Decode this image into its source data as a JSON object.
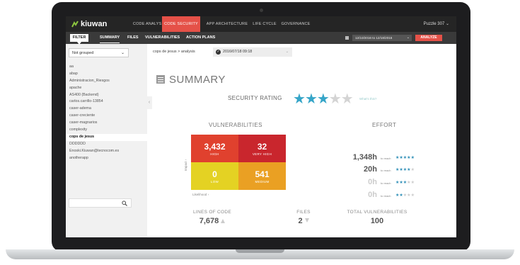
{
  "topnav": {
    "logo": "kiuwan",
    "items": [
      {
        "label": "CODE ANALYSIS"
      },
      {
        "label": "CODE SECURITY"
      },
      {
        "label": "APP ARCHITECTURE"
      },
      {
        "label": "LIFE CYCLE"
      },
      {
        "label": "GOVERNANCE"
      }
    ],
    "project": "Puzzle 307 ⌄"
  },
  "subnav": {
    "filter_label": "FILTER",
    "tabs": [
      {
        "label": "SUMMARY"
      },
      {
        "label": "FILES"
      },
      {
        "label": "VULNERABILITIES"
      },
      {
        "label": "ACTION PLANS"
      }
    ],
    "date_range": "12/10/2016 to 12/18/2016",
    "analyze_label": "ANALYZE"
  },
  "sidebar": {
    "group_select": "Not grouped",
    "apps": [
      "aa",
      "abap",
      "Administracion_Riesgos",
      "apache",
      "AS400 (Backend)",
      "carlos.carrillo-13854",
      "caser-adema",
      "caser-creciente",
      "caser-magnarios",
      "complexity",
      "cops de jesus",
      "DDDDDD",
      "Enoski.Kiuwan@tecnocom.es",
      "anotherapp"
    ],
    "selected_index": 10,
    "search_value": ""
  },
  "breadcrumb": {
    "path": "cops de jesus  >  analysis",
    "snapshot": "2016/07/18 09:18"
  },
  "summary": {
    "title": "SUMMARY",
    "rating_label": "SECURITY RATING",
    "rating_value": 3,
    "rating_max": 5,
    "whats_this": "What's this?"
  },
  "vulnerabilities": {
    "title": "VULNERABILITIES",
    "cells": [
      {
        "value": "3,432",
        "label": "HIGH",
        "color": "#e0412e"
      },
      {
        "value": "32",
        "label": "VERY HIGH",
        "color": "#c9262d"
      },
      {
        "value": "0",
        "label": "LOW",
        "color": "#e4d223"
      },
      {
        "value": "541",
        "label": "MEDIUM",
        "color": "#eaa023"
      }
    ],
    "impact_label": "Impact ›",
    "likelihood_label": "Likelihood ›"
  },
  "effort": {
    "title": "EFFORT",
    "rows": [
      {
        "hours": "1,348h",
        "reach": "to reach",
        "stars": 5
      },
      {
        "hours": "20h",
        "reach": "to reach",
        "stars": 4
      },
      {
        "hours": "0h",
        "reach": "to reach",
        "stars": 3
      },
      {
        "hours": "0h",
        "reach": "to reach",
        "stars": 2
      }
    ],
    "colors": {
      "active": "#2f8fb7",
      "dim": "#cccccc"
    }
  },
  "metrics": [
    {
      "label": "LINES OF CODE",
      "value": "7,678",
      "trend": "up"
    },
    {
      "label": "FILES",
      "value": "2",
      "trend": "down"
    },
    {
      "label": "TOTAL VULNERABILITIES",
      "value": "100",
      "trend": ""
    }
  ]
}
